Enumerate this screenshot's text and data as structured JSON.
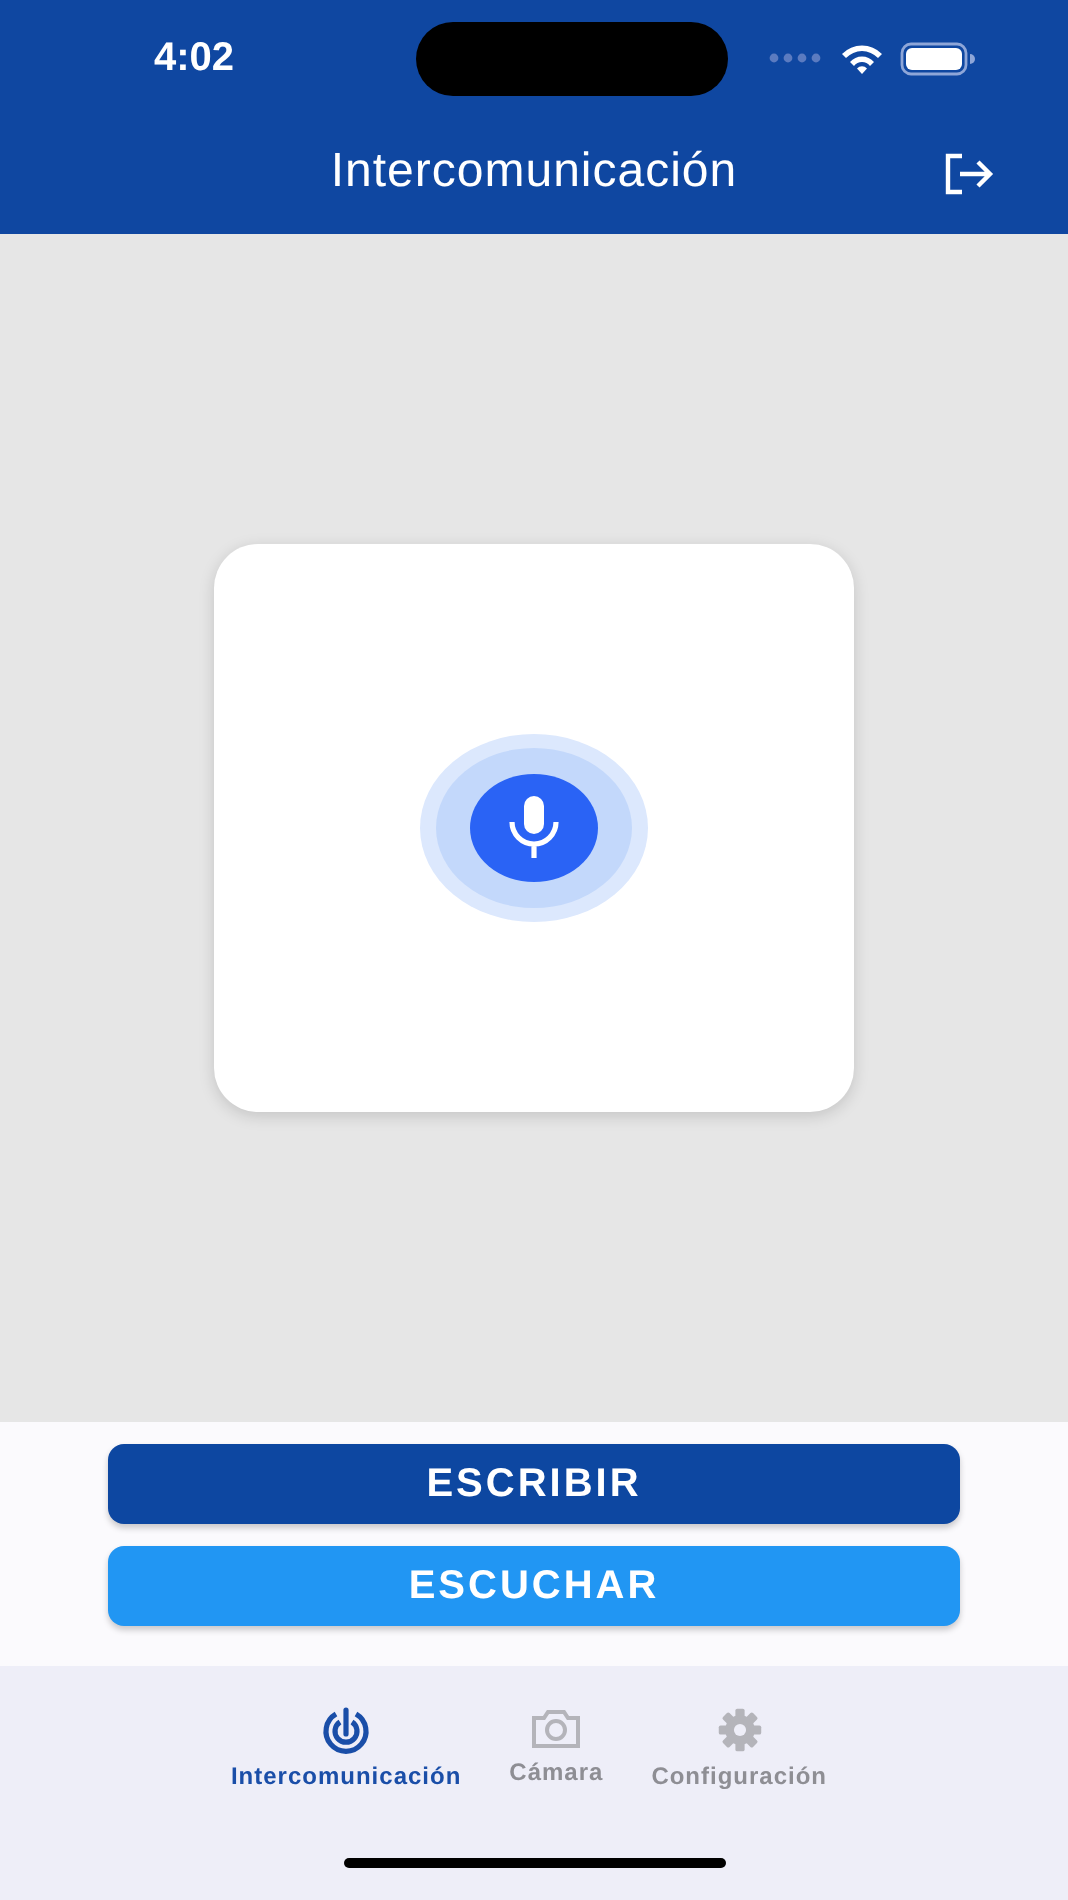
{
  "status_bar": {
    "time": "4:02"
  },
  "header": {
    "title": "Intercomunicación"
  },
  "dialog": {
    "kind": "recording"
  },
  "buttons": [
    {
      "label": "ESCRIBIR",
      "kind": "primary"
    },
    {
      "label": "ESCUCHAR",
      "kind": "secondary"
    }
  ],
  "tabs": [
    {
      "label": "Intercomunicación",
      "kind": "intercom",
      "selected": true
    },
    {
      "label": "Cámara",
      "kind": "camera",
      "selected": false
    },
    {
      "label": "Configuración",
      "kind": "settings",
      "selected": false
    }
  ]
}
